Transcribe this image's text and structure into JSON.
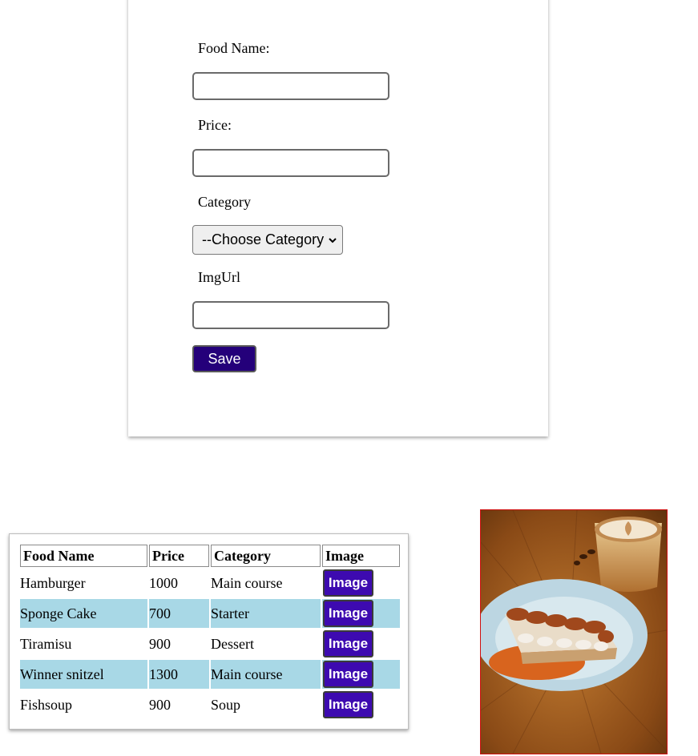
{
  "form": {
    "food_name_label": "Food Name:",
    "food_name_value": "",
    "price_label": "Price:",
    "price_value": "",
    "category_label": "Category",
    "category_selected": "--Choose Category",
    "imgurl_label": "ImgUrl",
    "imgurl_value": "",
    "save_label": "Save"
  },
  "table": {
    "headers": [
      "Food Name",
      "Price",
      "Category",
      "Image"
    ],
    "rows": [
      {
        "name": "Hamburger",
        "price": "1000",
        "category": "Main course",
        "image_label": "Image"
      },
      {
        "name": "Sponge Cake",
        "price": "700",
        "category": "Starter",
        "image_label": "Image"
      },
      {
        "name": "Tiramisu",
        "price": "900",
        "category": "Dessert",
        "image_label": "Image"
      },
      {
        "name": "Winner snitzel",
        "price": "1300",
        "category": "Main course",
        "image_label": "Image"
      },
      {
        "name": "Fishsoup",
        "price": "900",
        "category": "Soup",
        "image_label": "Image"
      }
    ],
    "alt_row_color": "#a8d8e6"
  },
  "preview": {
    "subject": "tiramisu-with-coffee-photo"
  },
  "colors": {
    "save_button": "#24007a",
    "image_button": "#3d0ab0",
    "photo_border": "#d01010"
  }
}
